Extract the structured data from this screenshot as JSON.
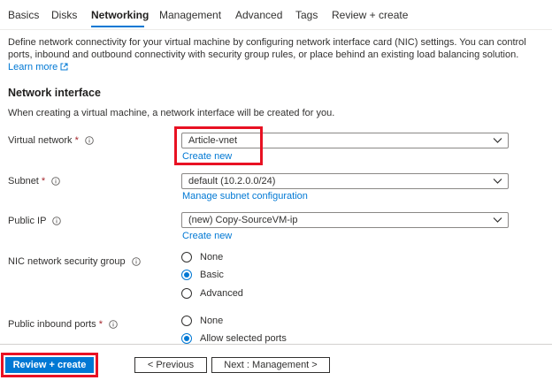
{
  "tabs": [
    {
      "label": "Basics",
      "active": false
    },
    {
      "label": "Disks",
      "active": false
    },
    {
      "label": "Networking",
      "active": true
    },
    {
      "label": "Management",
      "active": false
    },
    {
      "label": "Advanced",
      "active": false
    },
    {
      "label": "Tags",
      "active": false
    },
    {
      "label": "Review + create",
      "active": false
    }
  ],
  "intro": {
    "text": "Define network connectivity for your virtual machine by configuring network interface card (NIC) settings. You can control ports, inbound and outbound connectivity with security group rules, or place behind an existing load balancing solution.",
    "learn_more": "Learn more"
  },
  "network_interface": {
    "title": "Network interface",
    "note": "When creating a virtual machine, a network interface will be created for you."
  },
  "fields": {
    "virtual_network": {
      "label": "Virtual network",
      "required": "*",
      "value": "Article-vnet",
      "link": "Create new"
    },
    "subnet": {
      "label": "Subnet",
      "required": "*",
      "value": "default (10.2.0.0/24)",
      "link": "Manage subnet configuration"
    },
    "public_ip": {
      "label": "Public IP",
      "value": "(new) Copy-SourceVM-ip",
      "link": "Create new"
    },
    "nsg": {
      "label": "NIC network security group",
      "options": [
        {
          "label": "None",
          "checked": false
        },
        {
          "label": "Basic",
          "checked": true
        },
        {
          "label": "Advanced",
          "checked": false
        }
      ]
    },
    "inbound_ports": {
      "label": "Public inbound ports",
      "required": "*",
      "options": [
        {
          "label": "None",
          "checked": false
        },
        {
          "label": "Allow selected ports",
          "checked": true
        }
      ]
    }
  },
  "footer": {
    "review_create": "Review + create",
    "previous": "< Previous",
    "next": "Next : Management >"
  },
  "colors": {
    "accent": "#0078d4",
    "highlight": "#e81123",
    "required": "#a4262c"
  }
}
